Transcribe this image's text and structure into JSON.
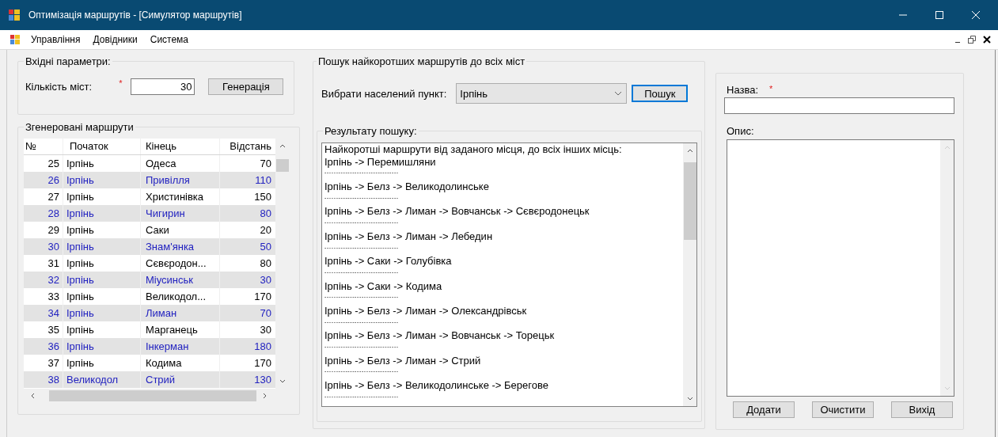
{
  "window": {
    "title": "Оптимізація маршрутів - [Симулятор маршрутів]"
  },
  "menu": [
    "Управління",
    "Довідники",
    "Система"
  ],
  "input_params": {
    "title": "Вхідні параметри:",
    "cities_label": "Кількість міст:",
    "required_mark": "*",
    "cities_value": "30",
    "generate_button": "Генерація"
  },
  "routes": {
    "title": "Згенеровані маршрути",
    "columns": [
      "№",
      "Початок",
      "Кінець",
      "Відстань"
    ],
    "rows": [
      [
        "25",
        "Ірпінь",
        "Одеса",
        "70"
      ],
      [
        "26",
        "Ірпінь",
        "Привілля",
        "110"
      ],
      [
        "27",
        "Ірпінь",
        "Христинівка",
        "150"
      ],
      [
        "28",
        "Ірпінь",
        "Чигирин",
        "80"
      ],
      [
        "29",
        "Ірпінь",
        "Саки",
        "20"
      ],
      [
        "30",
        "Ірпінь",
        "Знам'янка",
        "50"
      ],
      [
        "31",
        "Ірпінь",
        "Сєвєродон...",
        "80"
      ],
      [
        "32",
        "Ірпінь",
        "Міусинськ",
        "30"
      ],
      [
        "33",
        "Ірпінь",
        "Великодол...",
        "170"
      ],
      [
        "34",
        "Ірпінь",
        "Лиман",
        "70"
      ],
      [
        "35",
        "Ірпінь",
        "Марганець",
        "30"
      ],
      [
        "36",
        "Ірпінь",
        "Інкерман",
        "180"
      ],
      [
        "37",
        "Ірпінь",
        "Кодима",
        "170"
      ],
      [
        "38",
        "Великодол",
        "Стрий",
        "130"
      ]
    ]
  },
  "search": {
    "title": "Пошук найкоротших маршрутів до всіх міст",
    "city_label": "Вибрати населений пункт:",
    "city_value": "Ірпінь",
    "search_button": "Пошук",
    "results_title": "Результату пошуку:",
    "results": [
      {
        "kind": "text",
        "text": "Найкоротші маршрути від заданого місця, до всіх інших місць:"
      },
      {
        "kind": "text",
        "text": "Ірпінь -> Перемишляни"
      },
      {
        "kind": "separator",
        "text": "--------------------------------"
      },
      {
        "kind": "text",
        "text": "Ірпінь -> Белз -> Великодолинське"
      },
      {
        "kind": "separator",
        "text": "--------------------------------"
      },
      {
        "kind": "text",
        "text": "Ірпінь -> Белз -> Лиман -> Вовчанськ -> Сєвєродонецьк"
      },
      {
        "kind": "separator",
        "text": "--------------------------------"
      },
      {
        "kind": "text",
        "text": "Ірпінь -> Белз -> Лиман -> Лебедин"
      },
      {
        "kind": "separator",
        "text": "--------------------------------"
      },
      {
        "kind": "text",
        "text": "Ірпінь -> Саки -> Голубівка"
      },
      {
        "kind": "separator",
        "text": "--------------------------------"
      },
      {
        "kind": "text",
        "text": "Ірпінь -> Саки -> Кодима"
      },
      {
        "kind": "separator",
        "text": "--------------------------------"
      },
      {
        "kind": "text",
        "text": "Ірпінь -> Белз -> Лиман -> Олександрівськ"
      },
      {
        "kind": "separator",
        "text": "--------------------------------"
      },
      {
        "kind": "text",
        "text": "Ірпінь -> Белз -> Лиман -> Вовчанськ -> Торецьк"
      },
      {
        "kind": "separator",
        "text": "--------------------------------"
      },
      {
        "kind": "text",
        "text": "Ірпінь -> Белз -> Лиман -> Стрий"
      },
      {
        "kind": "separator",
        "text": "--------------------------------"
      },
      {
        "kind": "text",
        "text": "Ірпінь -> Белз -> Великодолинське -> Берегове"
      },
      {
        "kind": "separator",
        "text": "--------------------------------"
      }
    ]
  },
  "form": {
    "name_label": "Назва:",
    "required_mark": "*",
    "description_label": "Опис:",
    "buttons": [
      "Додати",
      "Очистити",
      "Вихід"
    ]
  }
}
